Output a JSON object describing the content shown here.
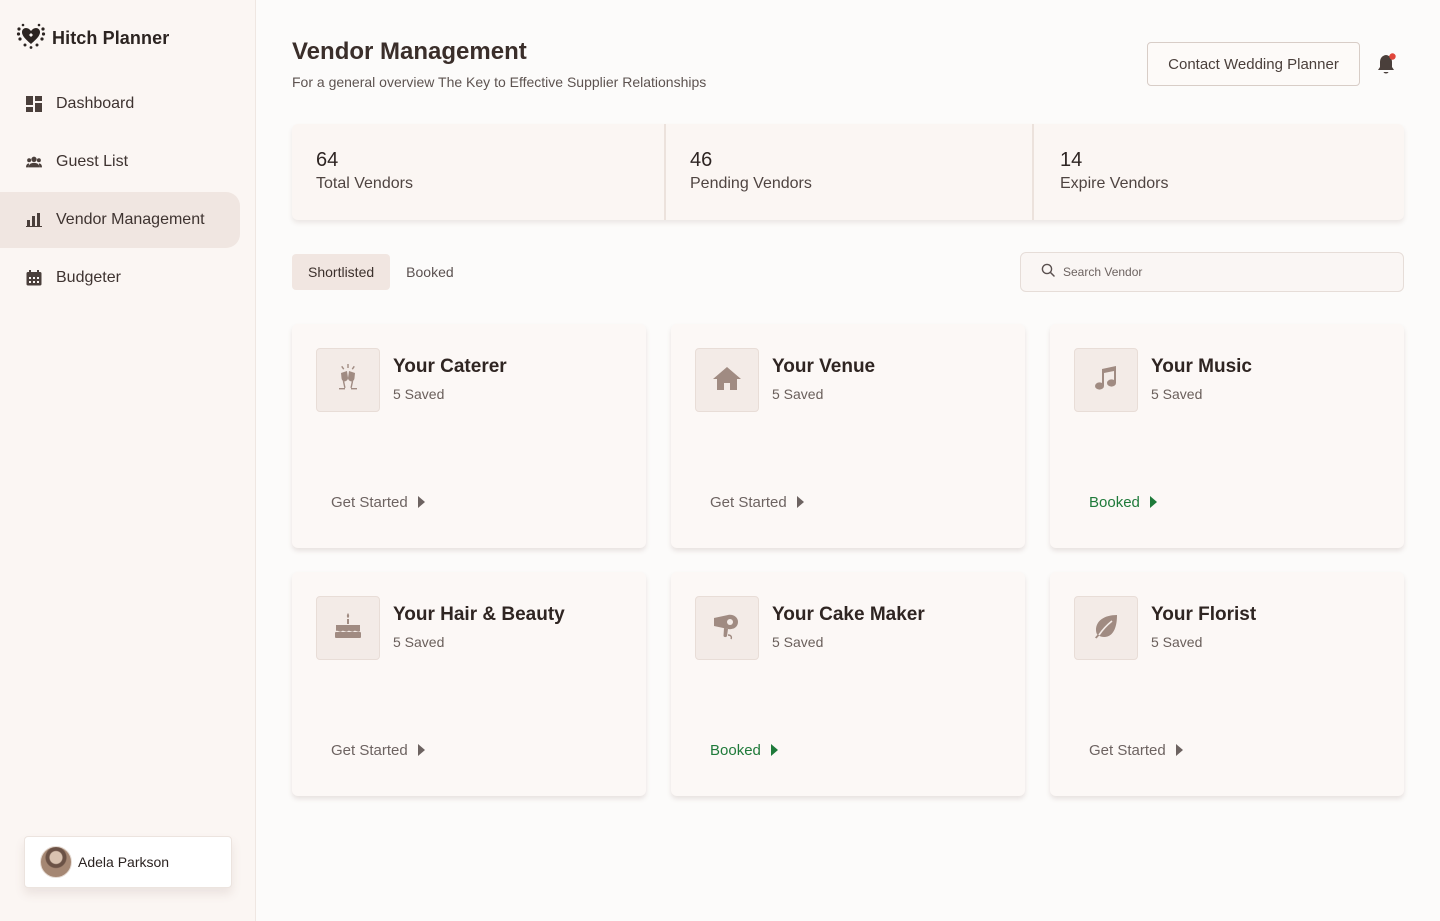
{
  "app": {
    "name": "Hitch Planner"
  },
  "sidebar": {
    "items": [
      {
        "label": "Dashboard",
        "icon": "dashboard-icon",
        "active": false
      },
      {
        "label": "Guest List",
        "icon": "people-icon",
        "active": false
      },
      {
        "label": "Vendor Management",
        "icon": "bar-chart-icon",
        "active": true
      },
      {
        "label": "Budgeter",
        "icon": "calendar-icon",
        "active": false
      }
    ],
    "user": {
      "name": "Adela Parkson"
    }
  },
  "header": {
    "title": "Vendor Management",
    "subtitle": "For a general overview The Key to Effective Supplier Relationships",
    "contact_label": "Contact Wedding Planner"
  },
  "stats": [
    {
      "value": "64",
      "label": "Total Vendors"
    },
    {
      "value": "46",
      "label": "Pending Vendors"
    },
    {
      "value": "14",
      "label": "Expire Vendors"
    }
  ],
  "tabs": [
    {
      "label": "Shortlisted",
      "active": true
    },
    {
      "label": "Booked",
      "active": false
    }
  ],
  "search": {
    "placeholder": "Search Vendor"
  },
  "cards": [
    {
      "title": "Your Caterer",
      "subtitle": "5 Saved",
      "icon": "cheers-glasses-icon",
      "action": "Get Started",
      "booked": false
    },
    {
      "title": "Your Venue",
      "subtitle": "5 Saved",
      "icon": "house-icon",
      "action": "Get Started",
      "booked": false
    },
    {
      "title": "Your Music",
      "subtitle": "5 Saved",
      "icon": "music-note-icon",
      "action": "Booked",
      "booked": true
    },
    {
      "title": "Your Hair & Beauty",
      "subtitle": "5 Saved",
      "icon": "cake-icon",
      "action": "Get Started",
      "booked": false
    },
    {
      "title": "Your Cake Maker",
      "subtitle": "5 Saved",
      "icon": "hair-dryer-icon",
      "action": "Booked",
      "booked": true
    },
    {
      "title": "Your Florist",
      "subtitle": "5 Saved",
      "icon": "leaf-icon",
      "action": "Get Started",
      "booked": false
    }
  ],
  "colors": {
    "accent_active_bg": "#f0e6e1",
    "booked_green": "#1f7a3a",
    "icon_brown": "#a08b82",
    "notification_dot": "#e0463a"
  }
}
